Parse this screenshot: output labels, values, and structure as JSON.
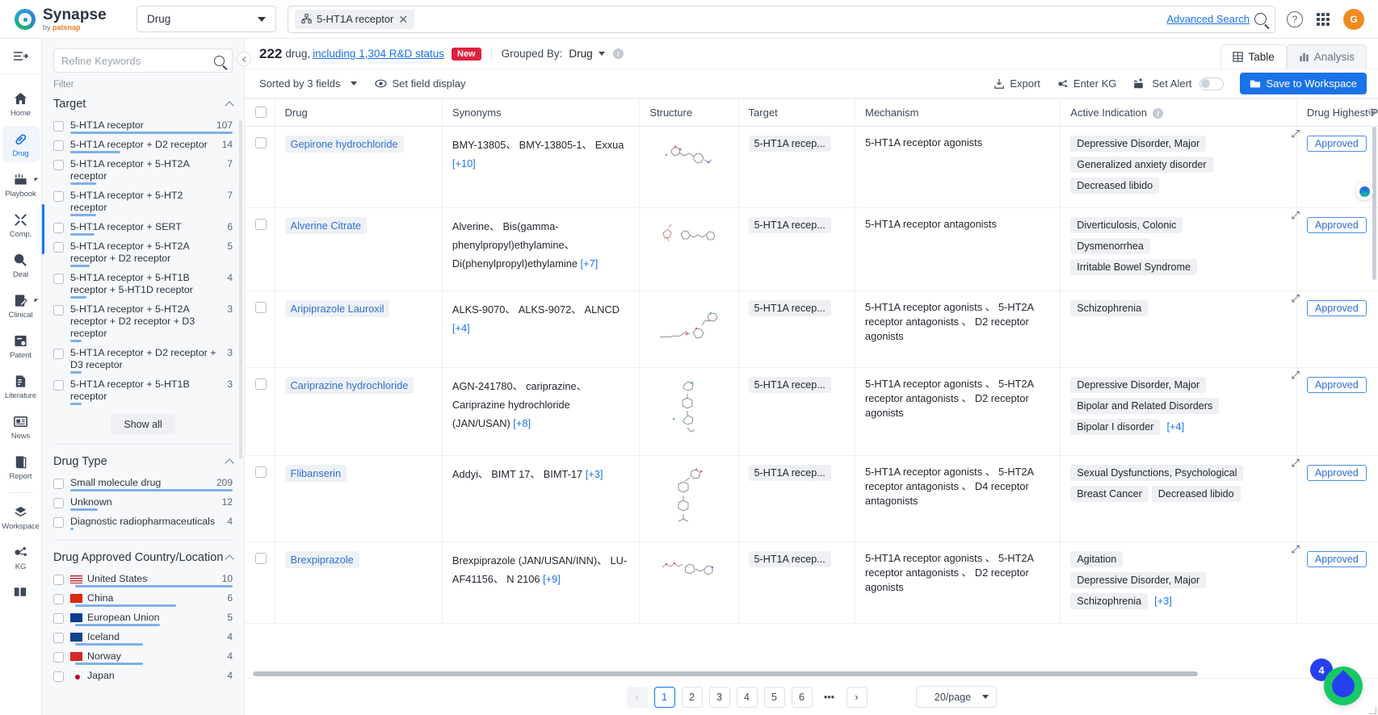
{
  "header": {
    "brand_name": "Synapse",
    "brand_sub_prefix": "by ",
    "brand_sub_name": "patsnap",
    "type_selector": "Drug",
    "search_chip": "5-HT1A receptor",
    "advanced_search": "Advanced Search",
    "avatar_initial": "G"
  },
  "rail": {
    "items": [
      {
        "label": "Home",
        "icon": "home-icon"
      },
      {
        "label": "Drug",
        "icon": "pill-icon"
      },
      {
        "label": "Playbook",
        "icon": "playbook-icon"
      },
      {
        "label": "Comp.",
        "icon": "compare-icon"
      },
      {
        "label": "Deal",
        "icon": "deal-icon"
      },
      {
        "label": "Clinical",
        "icon": "clinical-icon"
      },
      {
        "label": "Patent",
        "icon": "patent-icon"
      },
      {
        "label": "Literature",
        "icon": "literature-icon"
      },
      {
        "label": "News",
        "icon": "news-icon"
      },
      {
        "label": "Report",
        "icon": "report-icon"
      },
      {
        "label": "Workspace",
        "icon": "workspace-icon"
      },
      {
        "label": "KG",
        "icon": "kg-icon"
      }
    ]
  },
  "filters": {
    "refine_placeholder": "Refine Keywords",
    "filter_label": "Filter",
    "show_all": "Show all",
    "groups": [
      {
        "title": "Target",
        "items": [
          {
            "label": "5-HT1A receptor",
            "count": "107",
            "bar": 100
          },
          {
            "label": "5-HT1A receptor + D2 receptor",
            "count": "14",
            "bar": 31
          },
          {
            "label": "5-HT1A receptor + 5-HT2A receptor",
            "count": "7",
            "bar": 16
          },
          {
            "label": "5-HT1A receptor + 5-HT2 receptor",
            "count": "7",
            "bar": 16
          },
          {
            "label": "5-HT1A receptor + SERT",
            "count": "6",
            "bar": 15
          },
          {
            "label": "5-HT1A receptor + 5-HT2A receptor + D2 receptor",
            "count": "5",
            "bar": 12
          },
          {
            "label": "5-HT1A receptor + 5-HT1B receptor + 5-HT1D receptor",
            "count": "4",
            "bar": 10
          },
          {
            "label": "5-HT1A receptor + 5-HT2A receptor + D2 receptor + D3 receptor",
            "count": "3",
            "bar": 7
          },
          {
            "label": "5-HT1A receptor + D2 receptor + D3 receptor",
            "count": "3",
            "bar": 7
          },
          {
            "label": "5-HT1A receptor + 5-HT1B receptor",
            "count": "3",
            "bar": 7
          }
        ]
      },
      {
        "title": "Drug Type",
        "items": [
          {
            "label": "Small molecule drug",
            "count": "209",
            "bar": 100
          },
          {
            "label": "Unknown",
            "count": "12",
            "bar": 17
          },
          {
            "label": "Diagnostic radiopharmaceuticals",
            "count": "4",
            "bar": 2
          }
        ]
      },
      {
        "title": "Drug Approved Country/Location",
        "items": [
          {
            "label": "United States",
            "count": "10",
            "bar": 100,
            "flag": "us-flag"
          },
          {
            "label": "China",
            "count": "6",
            "bar": 64,
            "flag": "cn-flag"
          },
          {
            "label": "European Union",
            "count": "5",
            "bar": 54,
            "flag": "eu-flag"
          },
          {
            "label": "Iceland",
            "count": "4",
            "bar": 43,
            "flag": "is-flag"
          },
          {
            "label": "Norway",
            "count": "4",
            "bar": 43,
            "flag": "no-flag"
          },
          {
            "label": "Japan",
            "count": "4",
            "bar": 43,
            "flag": "jp-flag"
          }
        ]
      }
    ]
  },
  "results": {
    "count": "222",
    "unit": "drug,",
    "link": "including 1,304 R&D status",
    "badge": "New",
    "grouped_by_label": "Grouped By:",
    "grouped_by_value": "Drug",
    "tab_table": "Table",
    "tab_analysis": "Analysis"
  },
  "toolbar": {
    "sorted_by": "Sorted by 3 fields",
    "set_field_display": "Set field display",
    "export": "Export",
    "enter_kg": "Enter KG",
    "set_alert": "Set Alert",
    "save_to_workspace": "Save to Workspace"
  },
  "table": {
    "columns": [
      "Drug",
      "Synonyms",
      "Structure",
      "Target",
      "Mechanism",
      "Active Indication",
      "Drug Highest Phase"
    ],
    "rows": [
      {
        "drug": "Gepirone hydrochloride",
        "synonyms": "BMY-13805、 BMY-13805-1、 Exxua",
        "synonyms_more": "[+10]",
        "target": "5-HT1A recep...",
        "mechanism": "5-HT1A receptor agonists",
        "indications": [
          "Depressive Disorder, Major",
          "Generalized anxiety disorder",
          "Decreased libido"
        ],
        "indications_more": "",
        "phase": "Approved"
      },
      {
        "drug": "Alverine Citrate",
        "synonyms": "Alverine、 Bis(gamma-phenylpropyl)ethylamine、 Di(phenylpropyl)ethylamine",
        "synonyms_more": "[+7]",
        "target": "5-HT1A recep...",
        "mechanism": "5-HT1A receptor antagonists",
        "indications": [
          "Diverticulosis, Colonic",
          "Dysmenorrhea",
          "Irritable Bowel Syndrome"
        ],
        "indications_more": "",
        "phase": "Approved"
      },
      {
        "drug": "Aripiprazole Lauroxil",
        "synonyms": "ALKS-9070、 ALKS-9072、 ALNCD",
        "synonyms_more": "[+4]",
        "target": "5-HT1A recep...",
        "mechanism": "5-HT1A receptor agonists 、 5-HT2A receptor antagonists 、 D2 receptor agonists",
        "indications": [
          "Schizophrenia"
        ],
        "indications_more": "",
        "phase": "Approved"
      },
      {
        "drug": "Cariprazine hydrochloride",
        "synonyms": "AGN-241780、 cariprazine、 Cariprazine hydrochloride (JAN/USAN)",
        "synonyms_more": "[+8]",
        "target": "5-HT1A recep...",
        "mechanism": "5-HT1A receptor agonists 、 5-HT2A receptor antagonists 、 D2 receptor agonists",
        "indications": [
          "Depressive Disorder, Major",
          "Bipolar and Related Disorders",
          "Bipolar I disorder"
        ],
        "indications_more": "[+4]",
        "phase": "Approved"
      },
      {
        "drug": "Flibanserin",
        "synonyms": "Addyi、 BIMT 17、 BIMT-17",
        "synonyms_more": "[+3]",
        "target": "5-HT1A recep...",
        "mechanism": "5-HT1A receptor agonists 、 5-HT2A receptor antagonists 、 D4 receptor antagonists",
        "indications": [
          "Sexual Dysfunctions, Psychological",
          "Breast Cancer",
          "Decreased libido"
        ],
        "indications_more": "",
        "phase": "Approved"
      },
      {
        "drug": "Brexpiprazole",
        "synonyms": "Brexpiprazole (JAN/USAN/INN)、 LU-AF41156、 N 2106",
        "synonyms_more": "[+9]",
        "target": "5-HT1A recep...",
        "mechanism": "5-HT1A receptor agonists 、 5-HT2A receptor antagonists 、 D2 receptor agonists",
        "indications": [
          "Agitation",
          "Depressive Disorder, Major",
          "Schizophrenia"
        ],
        "indications_more": "[+3]",
        "phase": "Approved"
      }
    ]
  },
  "pagination": {
    "prev": "‹",
    "pages": [
      "1",
      "2",
      "3",
      "4",
      "5",
      "6"
    ],
    "ellipsis": "•••",
    "next": "›",
    "per_page": "20/page"
  },
  "floating": {
    "chat_badge": "4"
  }
}
